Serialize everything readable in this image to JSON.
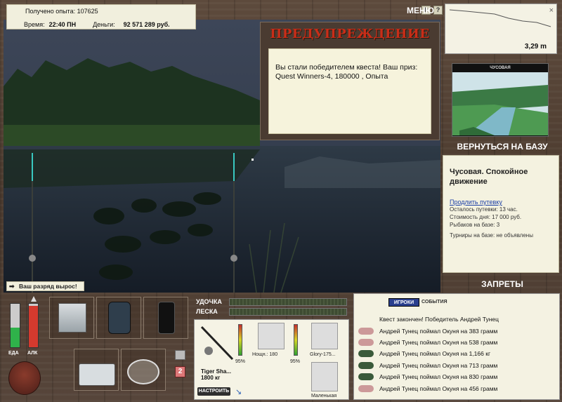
{
  "info": {
    "exp_label": "Получено опыта:",
    "exp_value": "107625",
    "time_label": "Время:",
    "time_value": "22:40 ПН",
    "money_label": "Деньги:",
    "money_value": "92 571 289 руб."
  },
  "top_controls": {
    "pause_label": "II",
    "help_label": "?",
    "menu_label": "МЕНЮ"
  },
  "warning": {
    "title": "ПРЕДУПРЕЖДЕНИЕ",
    "message": "Вы стали победителем квеста! Ваш приз: Quest Winners-4, 180000 , Опыта"
  },
  "depth": {
    "value": "3,29 m",
    "close": "×"
  },
  "location": {
    "image_caption": "ЧУСОВАЯ",
    "back_label": "ВЕРНУТЬСЯ НА БАЗУ",
    "title": "Чусовая. Спокойное движение",
    "extend_link": "Продлить путевку",
    "remaining": "Осталось путевки: 13 час.",
    "day_cost": "Стоимость дня: 17 000 руб.",
    "anglers": "Рыбаков на базе: 3",
    "tournaments": "Турниры на базе: не объявлены",
    "bans_label": "ЗАПРЕТЫ"
  },
  "rank_message": "Ваш разряд вырос!",
  "meters": {
    "food_label": "ЕДА",
    "food_level": 0.45,
    "alc_label": "АЛК",
    "alc_level": 0.95
  },
  "rod": {
    "rod_label": "УДОЧКА",
    "line_label": "ЛЕСКА",
    "rod_percent": "95%",
    "reel_percent": "95%",
    "rod_name": "Tiger Sha...",
    "rod_weight": "1800 кг",
    "reel_name": "Нощн.: 180",
    "line_name": "Glory-175...",
    "lure_name": "Маленькая",
    "setup_button": "НАСТРОИТЬ"
  },
  "slot_counts": {
    "box2": "2"
  },
  "log": {
    "tab_players": "ИГРОКИ",
    "tab_events": "СОБЫТИЯ",
    "lines": [
      "Квест закончен! Победитель Андрей Тунец",
      "Андрей Тунец поймал Окуня на 383 грамм",
      "Андрей Тунец поймал Окуня на 538 грамм",
      "Андрей Тунец поймал Окуня на 1,166 кг",
      "Андрей Тунец поймал Окуня на 713 грамм",
      "Андрей Тунец поймал Окуня на 830 грамм",
      "Андрей Тунец поймал Окуня на 456 грамм"
    ]
  },
  "colors": {
    "accent_red": "#c92d18",
    "link_blue": "#1a3ea6",
    "tab_blue": "#2a3f8e"
  }
}
